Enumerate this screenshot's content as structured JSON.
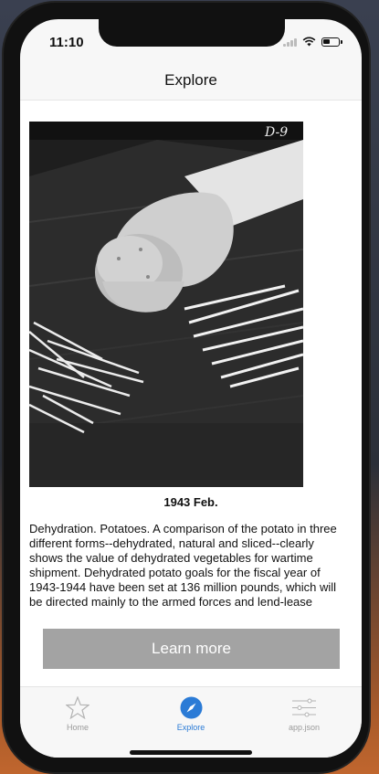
{
  "status_bar": {
    "time": "11:10"
  },
  "header": {
    "title": "Explore"
  },
  "article": {
    "image_label": "potato-photo",
    "date": "1943 Feb.",
    "description": "Dehydration. Potatoes. A comparison of the potato in three different forms--dehydrated, natural and sliced--clearly shows the value of dehydrated vegetables for wartime shipment. Dehydrated potato goals for the fiscal year of 1943-1944 have been set at 136 million pounds, which will be directed mainly to the armed forces and lend-lease",
    "learn_more_label": "Learn more"
  },
  "tab_bar": {
    "tabs": [
      {
        "label": "Home",
        "icon": "star-icon",
        "active": false
      },
      {
        "label": "Explore",
        "icon": "compass-icon",
        "active": true
      },
      {
        "label": "app.json",
        "icon": "sliders-icon",
        "active": false
      }
    ]
  },
  "colors": {
    "accent": "#2b7bd6",
    "button_bg": "#a3a3a3",
    "inactive": "#9a9a9a"
  }
}
